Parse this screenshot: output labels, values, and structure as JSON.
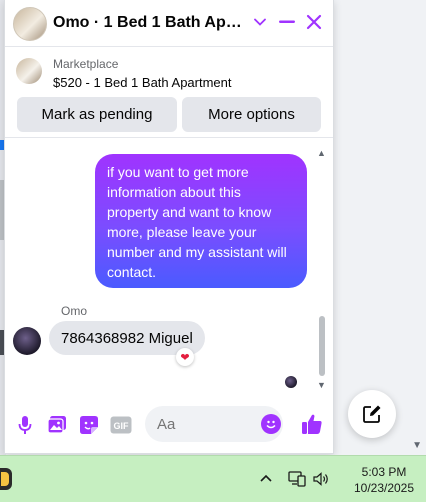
{
  "header": {
    "title": "Omo · 1 Bed 1 Bath Apart...",
    "icons": [
      "chevron-down-icon",
      "minimize-icon",
      "close-icon"
    ]
  },
  "listing": {
    "source": "Marketplace",
    "title": "$520 - 1 Bed 1 Bath Apartment",
    "mark_pending_label": "Mark as pending",
    "more_options_label": "More options"
  },
  "conversation": {
    "outgoing_message": "if you want to get more information about this property and want to know more, please leave your number and my assistant will contact.",
    "incoming_sender": "Omo",
    "incoming_message": "7864368982 Miguel",
    "reaction": "heart"
  },
  "composer": {
    "placeholder": "Aa",
    "icons": [
      "microphone-icon",
      "photo-icon",
      "sticker-icon",
      "gif-icon",
      "emoji-icon",
      "thumbs-up-icon"
    ],
    "gif_label": "GIF"
  },
  "taskbar": {
    "time": "5:03 PM",
    "date": "10/23/2025"
  },
  "colors": {
    "accent": "#a033ff",
    "bubble_gradient_top": "#a033ff",
    "bubble_gradient_bottom": "#4a5bff",
    "taskbar_bg": "#c6efc1"
  }
}
